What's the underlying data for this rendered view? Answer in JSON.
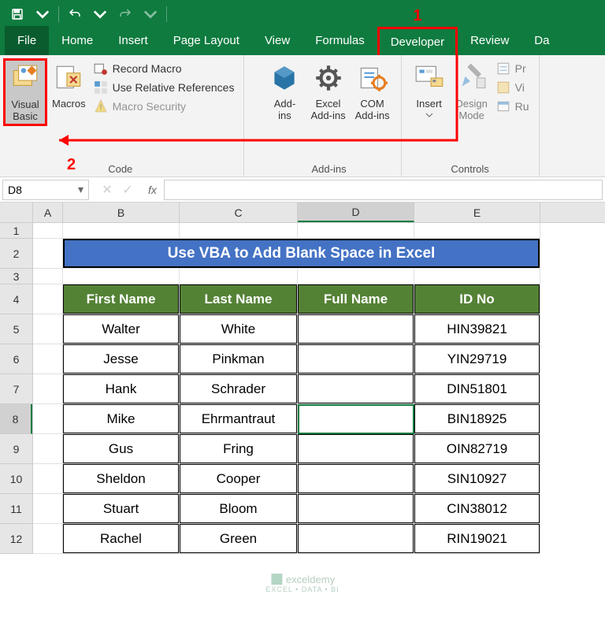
{
  "annotations": {
    "num1": "1",
    "num2": "2"
  },
  "titlebar": {
    "save_icon": "save-icon",
    "undo_icon": "undo-icon",
    "redo_icon": "redo-icon"
  },
  "tabs": {
    "file": "File",
    "items": [
      "Home",
      "Insert",
      "Page Layout",
      "View",
      "Formulas",
      "Developer",
      "Review",
      "Da"
    ]
  },
  "ribbon": {
    "group_code": {
      "label": "Code",
      "visual_basic": "Visual\nBasic",
      "macros": "Macros",
      "record_macro": "Record Macro",
      "use_relative": "Use Relative References",
      "macro_security": "Macro Security"
    },
    "group_addins": {
      "label": "Add-ins",
      "addins": "Add-\nins",
      "excel_addins": "Excel\nAdd-ins",
      "com_addins": "COM\nAdd-ins"
    },
    "group_controls": {
      "label": "Controls",
      "insert": "Insert",
      "design_mode": "Design\nMode",
      "properties": "Pr",
      "view_code": "Vi",
      "run_dialog": "Ru"
    }
  },
  "namebox": {
    "value": "D8"
  },
  "fx_label": "fx",
  "grid": {
    "cols": [
      "A",
      "B",
      "C",
      "D",
      "E"
    ],
    "rows": [
      "1",
      "2",
      "3",
      "4",
      "5",
      "6",
      "7",
      "8",
      "9",
      "10",
      "11",
      "12"
    ],
    "title": "Use VBA to Add Blank Space in Excel",
    "headers": [
      "First Name",
      "Last Name",
      "Full Name",
      "ID No"
    ],
    "data": [
      {
        "first": "Walter",
        "last": "White",
        "full": "",
        "id": "HIN39821"
      },
      {
        "first": "Jesse",
        "last": "Pinkman",
        "full": "",
        "id": "YIN29719"
      },
      {
        "first": "Hank",
        "last": "Schrader",
        "full": "",
        "id": "DIN51801"
      },
      {
        "first": "Mike",
        "last": "Ehrmantraut",
        "full": "",
        "id": "BIN18925"
      },
      {
        "first": "Gus",
        "last": "Fring",
        "full": "",
        "id": "OIN82719"
      },
      {
        "first": "Sheldon",
        "last": "Cooper",
        "full": "",
        "id": "SIN10927"
      },
      {
        "first": "Stuart",
        "last": "Bloom",
        "full": "",
        "id": "CIN38012"
      },
      {
        "first": "Rachel",
        "last": "Green",
        "full": "",
        "id": "RIN19021"
      }
    ]
  },
  "watermark": {
    "brand": "exceldemy",
    "tagline": "EXCEL • DATA • BI"
  }
}
